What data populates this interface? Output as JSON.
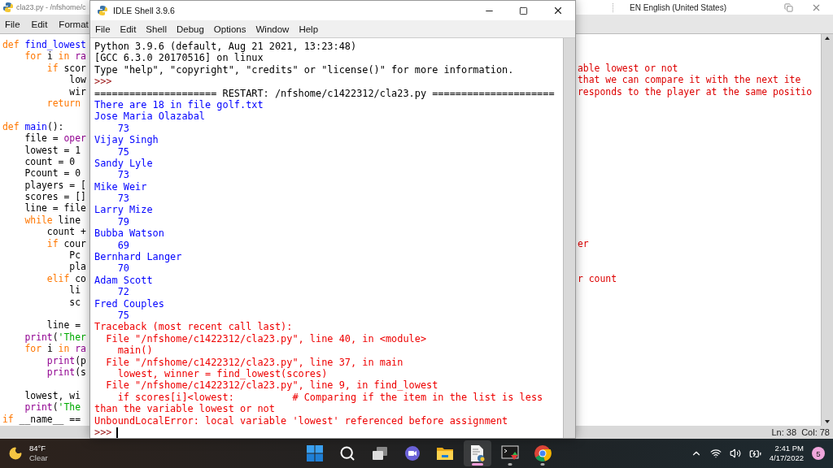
{
  "editor": {
    "title": "cla23.py - /nfshome/c",
    "menu": [
      "File",
      "Edit",
      "Format"
    ],
    "language": "EN English (United States)",
    "lines": [
      {
        "kind": "code",
        "code": [
          {
            "text": "def ",
            "kind": "keyword"
          },
          {
            "text": "find_lowest",
            "kind": "name"
          }
        ]
      },
      {
        "kind": "code",
        "code": [
          {
            "text": "    for ",
            "kind": "keyword"
          },
          {
            "text": "i ",
            "kind": "plain"
          },
          {
            "text": "in ",
            "kind": "keyword"
          },
          {
            "text": "ra",
            "kind": "builtin"
          }
        ]
      },
      {
        "kind": "code",
        "code": [
          {
            "text": "        if ",
            "kind": "keyword"
          },
          {
            "text": "scor",
            "kind": "plain"
          }
        ],
        "comment": "able lowest or not"
      },
      {
        "kind": "code",
        "code": [
          {
            "text": "            low",
            "kind": "plain"
          }
        ],
        "comment": "that we can compare it with the next ite"
      },
      {
        "kind": "code",
        "code": [
          {
            "text": "            wir",
            "kind": "plain"
          }
        ],
        "comment": "responds to the player at the same positio"
      },
      {
        "kind": "code",
        "code": [
          {
            "text": "        return",
            "kind": "keyword"
          }
        ]
      },
      {
        "kind": "blank"
      },
      {
        "kind": "code",
        "code": [
          {
            "text": "def ",
            "kind": "keyword"
          },
          {
            "text": "main",
            "kind": "name"
          },
          {
            "text": "():",
            "kind": "plain"
          }
        ]
      },
      {
        "kind": "code",
        "code": [
          {
            "text": "    file = ",
            "kind": "plain"
          },
          {
            "text": "oper",
            "kind": "builtin"
          }
        ]
      },
      {
        "kind": "code",
        "code": [
          {
            "text": "    lowest = 1",
            "kind": "plain"
          }
        ]
      },
      {
        "kind": "code",
        "code": [
          {
            "text": "    count = 0",
            "kind": "plain"
          }
        ]
      },
      {
        "kind": "code",
        "code": [
          {
            "text": "    Pcount = 0",
            "kind": "plain"
          }
        ]
      },
      {
        "kind": "code",
        "code": [
          {
            "text": "    players = [",
            "kind": "plain"
          }
        ]
      },
      {
        "kind": "code",
        "code": [
          {
            "text": "    scores = []",
            "kind": "plain"
          }
        ]
      },
      {
        "kind": "code",
        "code": [
          {
            "text": "    line = file",
            "kind": "plain"
          }
        ]
      },
      {
        "kind": "code",
        "code": [
          {
            "text": "    while ",
            "kind": "keyword"
          },
          {
            "text": "line",
            "kind": "plain"
          }
        ]
      },
      {
        "kind": "code",
        "code": [
          {
            "text": "        count +",
            "kind": "plain"
          }
        ]
      },
      {
        "kind": "code",
        "code": [
          {
            "text": "        if ",
            "kind": "keyword"
          },
          {
            "text": "cour",
            "kind": "plain"
          }
        ],
        "comment": "er"
      },
      {
        "kind": "code",
        "code": [
          {
            "text": "            Pc",
            "kind": "plain"
          }
        ]
      },
      {
        "kind": "code",
        "code": [
          {
            "text": "            pla",
            "kind": "plain"
          }
        ]
      },
      {
        "kind": "code",
        "code": [
          {
            "text": "        elif ",
            "kind": "keyword"
          },
          {
            "text": "co",
            "kind": "plain"
          }
        ],
        "comment": "r count"
      },
      {
        "kind": "code",
        "code": [
          {
            "text": "            li",
            "kind": "plain"
          }
        ]
      },
      {
        "kind": "code",
        "code": [
          {
            "text": "            sc",
            "kind": "plain"
          }
        ]
      },
      {
        "kind": "blank"
      },
      {
        "kind": "code",
        "code": [
          {
            "text": "        line =",
            "kind": "plain"
          }
        ]
      },
      {
        "kind": "code",
        "code": [
          {
            "text": "    print",
            "kind": "builtin"
          },
          {
            "text": "(",
            "kind": "plain"
          },
          {
            "text": "'Ther",
            "kind": "string"
          }
        ]
      },
      {
        "kind": "code",
        "code": [
          {
            "text": "    for ",
            "kind": "keyword"
          },
          {
            "text": "i ",
            "kind": "plain"
          },
          {
            "text": "in ",
            "kind": "keyword"
          },
          {
            "text": "ra",
            "kind": "builtin"
          }
        ]
      },
      {
        "kind": "code",
        "code": [
          {
            "text": "        print",
            "kind": "builtin"
          },
          {
            "text": "(p",
            "kind": "plain"
          }
        ]
      },
      {
        "kind": "code",
        "code": [
          {
            "text": "        print",
            "kind": "builtin"
          },
          {
            "text": "(s",
            "kind": "plain"
          }
        ]
      },
      {
        "kind": "blank"
      },
      {
        "kind": "code",
        "code": [
          {
            "text": "    lowest, wi",
            "kind": "plain"
          }
        ]
      },
      {
        "kind": "code",
        "code": [
          {
            "text": "    print",
            "kind": "builtin"
          },
          {
            "text": "(",
            "kind": "plain"
          },
          {
            "text": "'The",
            "kind": "string"
          }
        ]
      },
      {
        "kind": "code",
        "code": [
          {
            "text": "if ",
            "kind": "keyword"
          },
          {
            "text": "__name__ ==",
            "kind": "plain"
          }
        ]
      }
    ],
    "status": "Ln: 38  Col: 78"
  },
  "shell": {
    "title": "IDLE Shell 3.9.6",
    "menu": [
      "File",
      "Edit",
      "Shell",
      "Debug",
      "Options",
      "Window",
      "Help"
    ],
    "lines": [
      {
        "kind": "banner",
        "text": "Python 3.9.6 (default, Aug 21 2021, 13:23:48)"
      },
      {
        "kind": "banner",
        "text": "[GCC 6.3.0 20170516] on linux"
      },
      {
        "kind": "banner",
        "text": "Type \"help\", \"copyright\", \"credits\" or \"license()\" for more information."
      },
      {
        "kind": "prompt",
        "text": ">>>"
      },
      {
        "kind": "banner",
        "text": "===================== RESTART: /nfshome/c1422312/cla23.py ====================="
      },
      {
        "kind": "output",
        "text": "There are 18 in file golf.txt"
      },
      {
        "kind": "output",
        "text": "Jose Maria Olazabal"
      },
      {
        "kind": "output",
        "text": "    73"
      },
      {
        "kind": "output",
        "text": "Vijay Singh"
      },
      {
        "kind": "output",
        "text": "    75"
      },
      {
        "kind": "output",
        "text": "Sandy Lyle"
      },
      {
        "kind": "output",
        "text": "    73"
      },
      {
        "kind": "output",
        "text": "Mike Weir"
      },
      {
        "kind": "output",
        "text": "    73"
      },
      {
        "kind": "output",
        "text": "Larry Mize"
      },
      {
        "kind": "output",
        "text": "    79"
      },
      {
        "kind": "output",
        "text": "Bubba Watson"
      },
      {
        "kind": "output",
        "text": "    69"
      },
      {
        "kind": "output",
        "text": "Bernhard Langer"
      },
      {
        "kind": "output",
        "text": "    70"
      },
      {
        "kind": "output",
        "text": "Adam Scott"
      },
      {
        "kind": "output",
        "text": "    72"
      },
      {
        "kind": "output",
        "text": "Fred Couples"
      },
      {
        "kind": "output",
        "text": "    75"
      },
      {
        "kind": "error",
        "text": "Traceback (most recent call last):"
      },
      {
        "kind": "error",
        "text": "  File \"/nfshome/c1422312/cla23.py\", line 40, in <module>"
      },
      {
        "kind": "error",
        "text": "    main()"
      },
      {
        "kind": "error",
        "text": "  File \"/nfshome/c1422312/cla23.py\", line 37, in main"
      },
      {
        "kind": "error",
        "text": "    lowest, winner = find_lowest(scores)"
      },
      {
        "kind": "error",
        "text": "  File \"/nfshome/c1422312/cla23.py\", line 9, in find_lowest"
      },
      {
        "kind": "error",
        "text": "    if scores[i]<lowest:          # Comparing if the item in the list is less"
      },
      {
        "kind": "error",
        "text": "than the variable lowest or not"
      },
      {
        "kind": "error",
        "text": "UnboundLocalError: local variable 'lowest' referenced before assignment"
      },
      {
        "kind": "prompt",
        "text": ">>>",
        "cursor": true
      }
    ]
  },
  "taskbar": {
    "weather": {
      "temperature": "84°F",
      "condition": "Clear"
    },
    "apps": [
      {
        "kind": "start",
        "active": false,
        "running": false
      },
      {
        "kind": "search",
        "active": false,
        "running": false
      },
      {
        "kind": "taskview",
        "active": false,
        "running": false
      },
      {
        "kind": "chat",
        "active": false,
        "running": false
      },
      {
        "kind": "folder",
        "active": false,
        "running": false
      },
      {
        "kind": "idle",
        "active": true,
        "running": true
      },
      {
        "kind": "terminal",
        "active": false,
        "running": true
      },
      {
        "kind": "browser",
        "active": false,
        "running": true
      }
    ],
    "time": "2:41 PM",
    "date": "4/17/2022",
    "notifications": "5"
  }
}
